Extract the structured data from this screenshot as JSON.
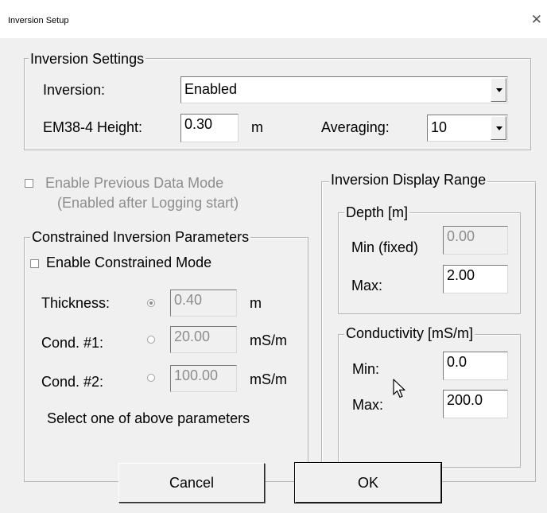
{
  "window": {
    "title": "Inversion Setup",
    "close": "✕"
  },
  "inversion_settings": {
    "legend": "Inversion Settings",
    "inversion_label": "Inversion:",
    "inversion_value": "Enabled",
    "height_label": "EM38-4 Height:",
    "height_value": "0.30",
    "height_unit": "m",
    "averaging_label": "Averaging:",
    "averaging_value": "10"
  },
  "previous_mode": {
    "label": "Enable Previous Data Mode",
    "note": "(Enabled after Logging start)",
    "checked": false,
    "enabled": false
  },
  "constrained": {
    "legend": "Constrained Inversion Parameters",
    "enable_label": "Enable Constrained Mode",
    "enable_checked": false,
    "params": [
      {
        "label": "Thickness:",
        "value": "0.40",
        "unit": "m",
        "selected": true
      },
      {
        "label": "Cond. #1:",
        "value": "20.00",
        "unit": "mS/m",
        "selected": false
      },
      {
        "label": "Cond. #2:",
        "value": "100.00",
        "unit": "mS/m",
        "selected": false
      }
    ],
    "hint": "Select one of above parameters"
  },
  "display_range": {
    "legend": "Inversion Display Range",
    "depth": {
      "legend": "Depth [m]",
      "min_label": "Min (fixed)",
      "min_value": "0.00",
      "max_label": "Max:",
      "max_value": "2.00"
    },
    "conductivity": {
      "legend": "Conductivity [mS/m]",
      "min_label": "Min:",
      "min_value": "0.0",
      "max_label": "Max:",
      "max_value": "200.0"
    }
  },
  "buttons": {
    "cancel": "Cancel",
    "ok": "OK"
  }
}
